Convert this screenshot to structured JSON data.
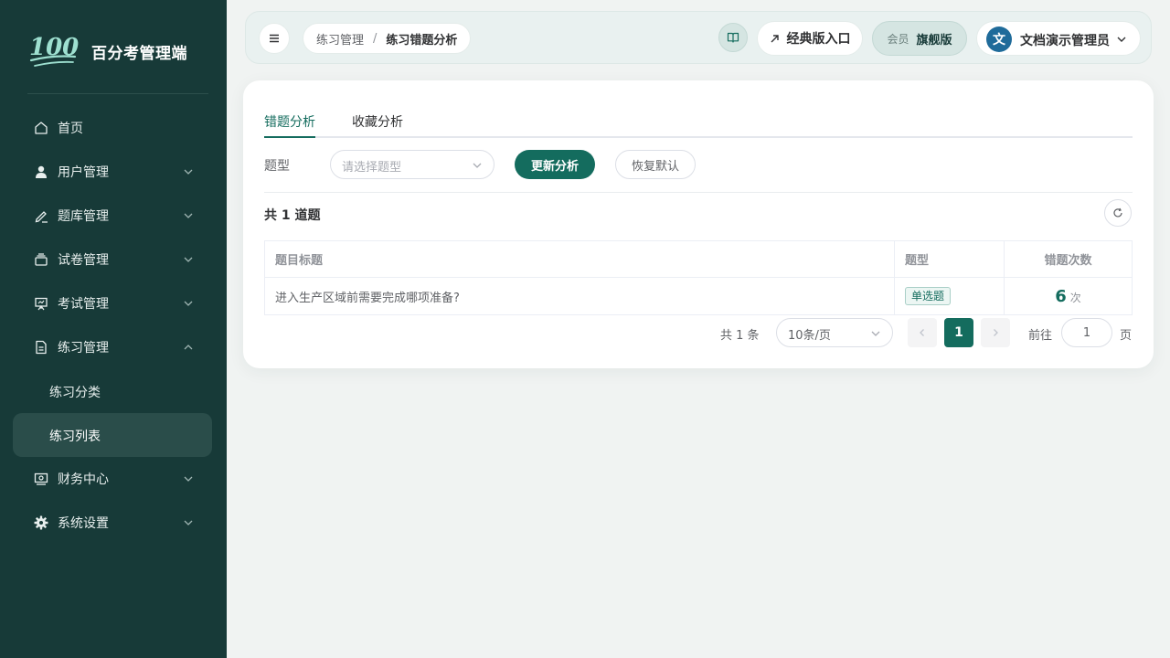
{
  "brand": {
    "title": "百分考管理端",
    "logo_text": "100"
  },
  "sidebar": {
    "items": [
      {
        "label": "首页",
        "icon": "home-icon"
      },
      {
        "label": "用户管理",
        "icon": "user-icon"
      },
      {
        "label": "题库管理",
        "icon": "edit-icon"
      },
      {
        "label": "试卷管理",
        "icon": "stack-icon"
      },
      {
        "label": "考试管理",
        "icon": "presentation-icon"
      },
      {
        "label": "练习管理",
        "icon": "document-icon"
      },
      {
        "label": "财务中心",
        "icon": "wallet-icon"
      },
      {
        "label": "系统设置",
        "icon": "gear-icon"
      }
    ],
    "subitems": [
      {
        "label": "练习分类"
      },
      {
        "label": "练习列表"
      }
    ]
  },
  "header": {
    "breadcrumb": [
      "练习管理",
      "练习错题分析"
    ],
    "breadcrumb_sep": "/",
    "classic_label": "经典版入口",
    "member_label": "会员",
    "member_level": "旗舰版",
    "avatar_char": "文",
    "user_name": "文档演示管理员"
  },
  "tabs": [
    {
      "label": "错题分析"
    },
    {
      "label": "收藏分析"
    }
  ],
  "filter": {
    "label": "题型",
    "placeholder": "请选择题型",
    "update_button": "更新分析",
    "reset_button": "恢复默认"
  },
  "summary": {
    "count_text": "共 1 道题"
  },
  "table": {
    "columns": [
      "题目标题",
      "题型",
      "错题次数"
    ],
    "rows": [
      {
        "title": "进入生产区域前需要完成哪项准备?",
        "type": "单选题",
        "count": "6",
        "unit": "次"
      }
    ]
  },
  "pagination": {
    "total": "共 1 条",
    "page_size": "10条/页",
    "current": "1",
    "goto_label": "前往",
    "goto_value": "1",
    "page_label": "页"
  },
  "colors": {
    "sidebar_bg": "#173a38",
    "primary": "#146c5e",
    "avatar": "#1f6b9a"
  }
}
